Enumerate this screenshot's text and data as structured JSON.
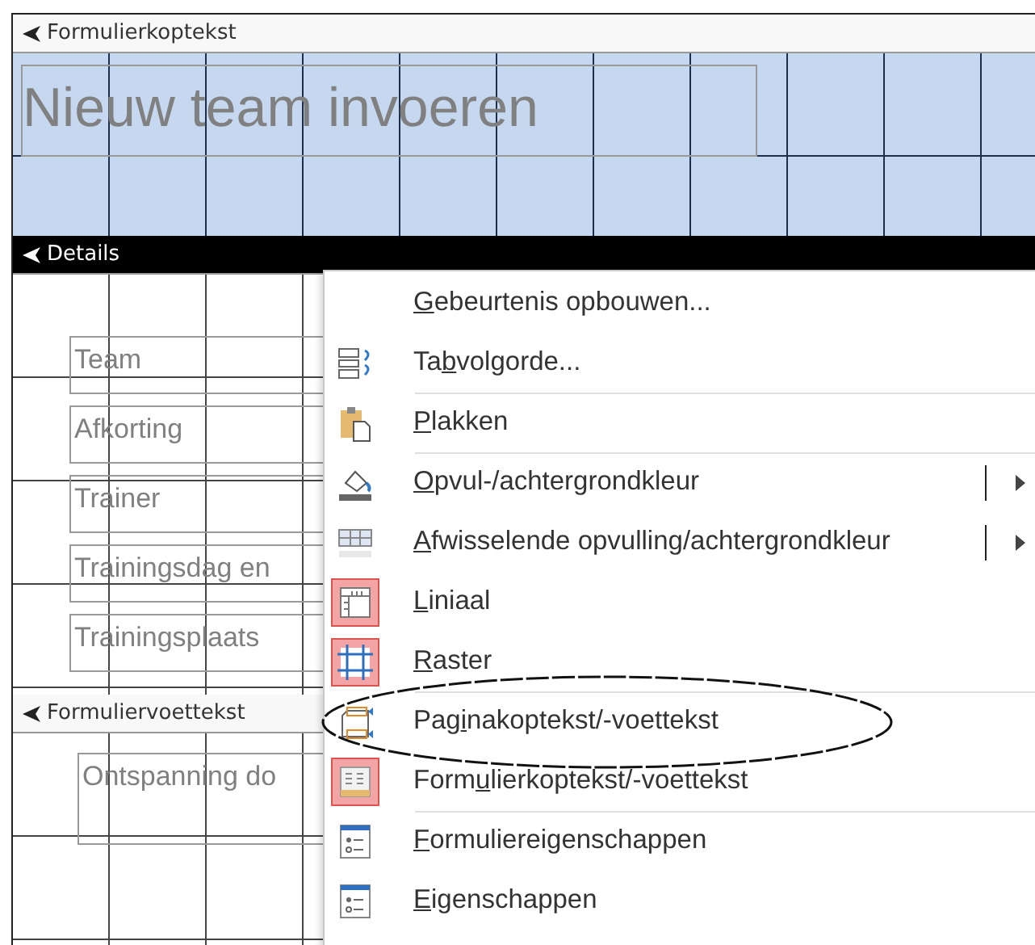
{
  "sections": [
    {
      "kind": "header",
      "title": "Formulierkoptekst",
      "selected": false,
      "labels": [
        {
          "text": "Nieuw team invoeren"
        }
      ]
    },
    {
      "kind": "detail",
      "title": "Details",
      "selected": true,
      "labels": [
        {
          "text": "Team"
        },
        {
          "text": "Afkorting"
        },
        {
          "text": "Trainer"
        },
        {
          "text": "Trainingsdag en"
        },
        {
          "text": "Trainingsplaats"
        }
      ]
    },
    {
      "kind": "footer",
      "title": "Formuliervoettekst",
      "selected": false,
      "labels": [
        {
          "text": "Ontspanning do"
        }
      ]
    }
  ],
  "menu": {
    "items": [
      {
        "key": "G",
        "after": "ebeurtenis opbouwen...",
        "checked": false,
        "submenu": false,
        "separator_before": false,
        "highlighted": false
      },
      {
        "before": "Ta",
        "key": "b",
        "after": "volgorde...",
        "checked": false,
        "submenu": false,
        "separator_before": false,
        "highlighted": false
      },
      {
        "key": "P",
        "after": "lakken",
        "checked": false,
        "submenu": false,
        "separator_before": true,
        "highlighted": false
      },
      {
        "key": "O",
        "after": "pvul-/achtergrondkleur",
        "checked": false,
        "submenu": true,
        "separator_before": true,
        "highlighted": false
      },
      {
        "key": "A",
        "after": "fwisselende opvulling/achtergrondkleur",
        "checked": false,
        "submenu": true,
        "separator_before": false,
        "highlighted": false
      },
      {
        "key": "L",
        "after": "iniaal",
        "checked": true,
        "submenu": false,
        "separator_before": false,
        "highlighted": false
      },
      {
        "key": "R",
        "after": "aster",
        "checked": true,
        "submenu": false,
        "separator_before": false,
        "highlighted": false
      },
      {
        "before": "Pag",
        "key": "i",
        "after": "nakoptekst/-voettekst",
        "checked": false,
        "submenu": false,
        "separator_before": true,
        "highlighted": true
      },
      {
        "before": "Form",
        "key": "u",
        "after": "lierkoptekst/-voettekst",
        "checked": true,
        "submenu": false,
        "separator_before": false,
        "highlighted": false
      },
      {
        "key": "F",
        "after": "ormuliereigenschappen",
        "checked": false,
        "submenu": false,
        "separator_before": true,
        "highlighted": false
      },
      {
        "key": "E",
        "after": "igenschappen",
        "checked": false,
        "submenu": false,
        "separator_before": false,
        "highlighted": false
      }
    ]
  }
}
